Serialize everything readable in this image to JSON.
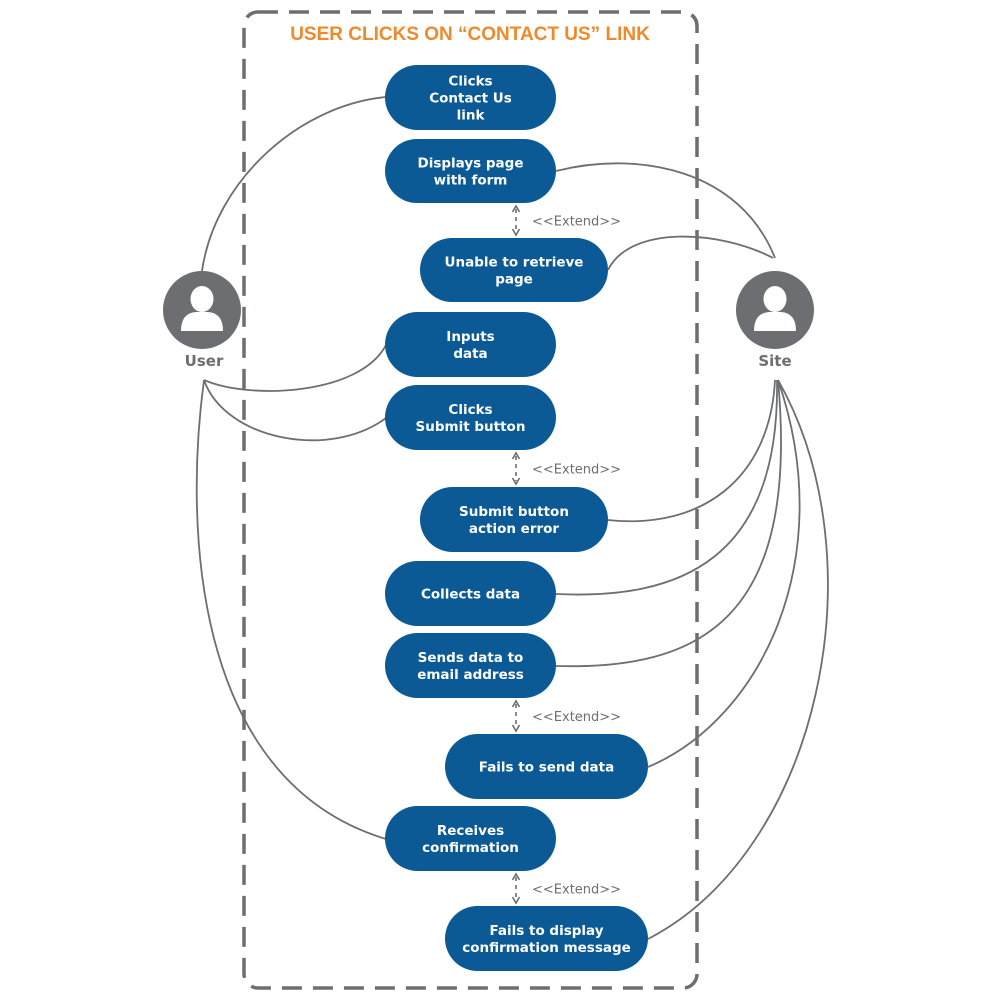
{
  "title": "USER CLICKS ON “CONTACT US” LINK",
  "colors": {
    "pill": "#0b5a96",
    "title": "#f0892a",
    "actor": "#6d6e71",
    "line": "#6d6e71"
  },
  "actors": [
    {
      "id": "user",
      "label": "User",
      "icon": "person-icon"
    },
    {
      "id": "site",
      "label": "Site",
      "icon": "person-icon"
    }
  ],
  "use_cases": [
    {
      "id": "uc1",
      "lines": [
        "Clicks",
        "Contact Us",
        "link"
      ],
      "actor": "user"
    },
    {
      "id": "uc2",
      "lines": [
        "Displays page",
        "with form"
      ],
      "actor": "site"
    },
    {
      "id": "uc3",
      "lines": [
        "Unable to retrieve",
        "page"
      ],
      "actor": "site"
    },
    {
      "id": "uc4",
      "lines": [
        "Inputs",
        "data"
      ],
      "actor": "user"
    },
    {
      "id": "uc5",
      "lines": [
        "Clicks",
        "Submit button"
      ],
      "actor": "user"
    },
    {
      "id": "uc6",
      "lines": [
        "Submit button",
        "action error"
      ],
      "actor": "site"
    },
    {
      "id": "uc7",
      "lines": [
        "Collects data"
      ],
      "actor": "site"
    },
    {
      "id": "uc8",
      "lines": [
        "Sends data to",
        "email address"
      ],
      "actor": "site"
    },
    {
      "id": "uc9",
      "lines": [
        "Fails to send data"
      ],
      "actor": "site"
    },
    {
      "id": "uc10",
      "lines": [
        "Receives",
        "confirmation"
      ],
      "actor": "user"
    },
    {
      "id": "uc11",
      "lines": [
        "Fails to display",
        "confirmation message"
      ],
      "actor": "site"
    }
  ],
  "extends": [
    {
      "from": "uc2",
      "to": "uc3",
      "label": "<<Extend>>"
    },
    {
      "from": "uc5",
      "to": "uc6",
      "label": "<<Extend>>"
    },
    {
      "from": "uc8",
      "to": "uc9",
      "label": "<<Extend>>"
    },
    {
      "from": "uc10",
      "to": "uc11",
      "label": "<<Extend>>"
    }
  ]
}
